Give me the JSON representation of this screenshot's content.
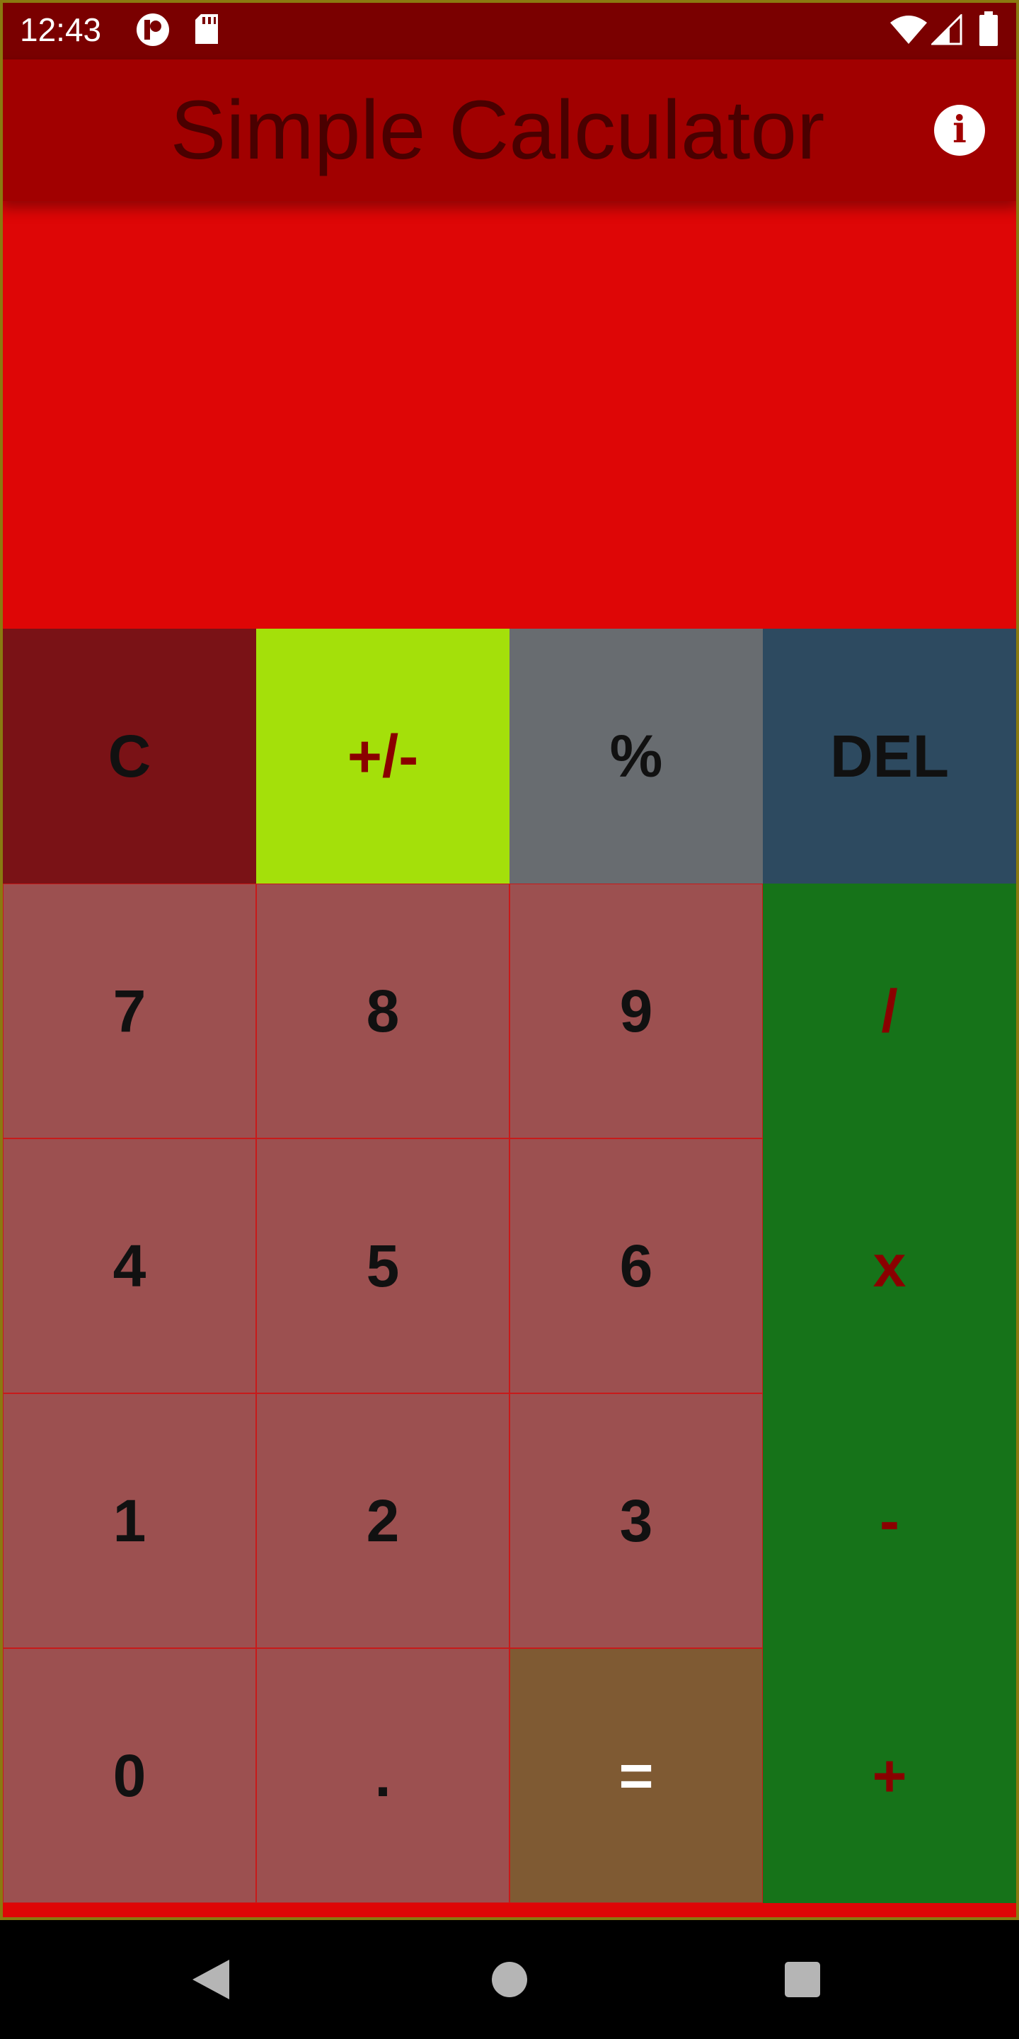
{
  "status_bar": {
    "time": "12:43",
    "left_icons": [
      "notification-icon",
      "sd-card-icon"
    ],
    "right_icons": [
      "wifi-icon",
      "signal-icon",
      "battery-icon"
    ]
  },
  "app_bar": {
    "title": "Simple Calculator",
    "info_glyph": "i"
  },
  "display": {
    "value": ""
  },
  "keypad": {
    "clear": "C",
    "sign": "+/-",
    "percent": "%",
    "delete": "DEL",
    "seven": "7",
    "eight": "8",
    "nine": "9",
    "divide": "/",
    "four": "4",
    "five": "5",
    "six": "6",
    "multiply": "x",
    "one": "1",
    "two": "2",
    "three": "3",
    "subtract": "-",
    "zero": "0",
    "decimal": ".",
    "equals": "=",
    "add": "+"
  },
  "nav_bar": {
    "buttons": [
      "back-icon",
      "home-icon",
      "recents-icon"
    ]
  },
  "colors": {
    "status_bar": "#7a0000",
    "app_bar": "#a10000",
    "display": "#de0606",
    "number_key": "#9c5050",
    "operator_key": "#167319",
    "clear_key": "#7a1216",
    "sign_key": "#a4e00a",
    "percent_key": "#686c70",
    "delete_key": "#2d4a60",
    "equals_key": "#7f5a33"
  }
}
